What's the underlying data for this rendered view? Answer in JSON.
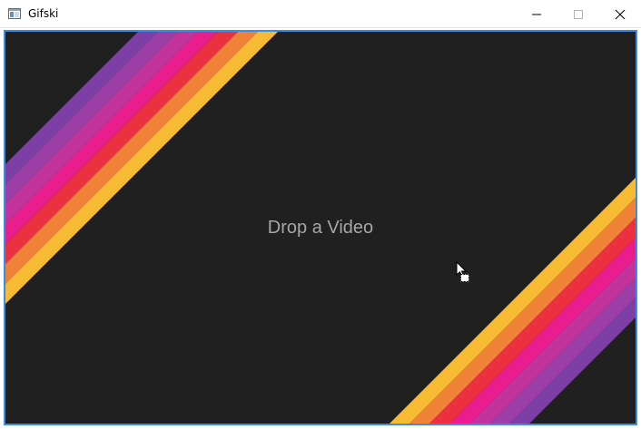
{
  "window": {
    "title": "Gifski",
    "accent_border": "#3a8ee6",
    "background": "#202020"
  },
  "titlebar": {
    "app_icon": "window-app-icon",
    "minimize_icon": "minimize-icon",
    "maximize_icon": "maximize-icon",
    "close_icon": "close-icon"
  },
  "main": {
    "drop_label": "Drop a Video",
    "drop_label_color": "#a6a6a6",
    "stripe_colors": [
      "#f7bb33",
      "#f08238",
      "#eb3040",
      "#e91e8c",
      "#c2349b",
      "#9b3fa6",
      "#7b3fa6"
    ]
  },
  "cursor": {
    "icon": "drag-copy-cursor-icon"
  }
}
